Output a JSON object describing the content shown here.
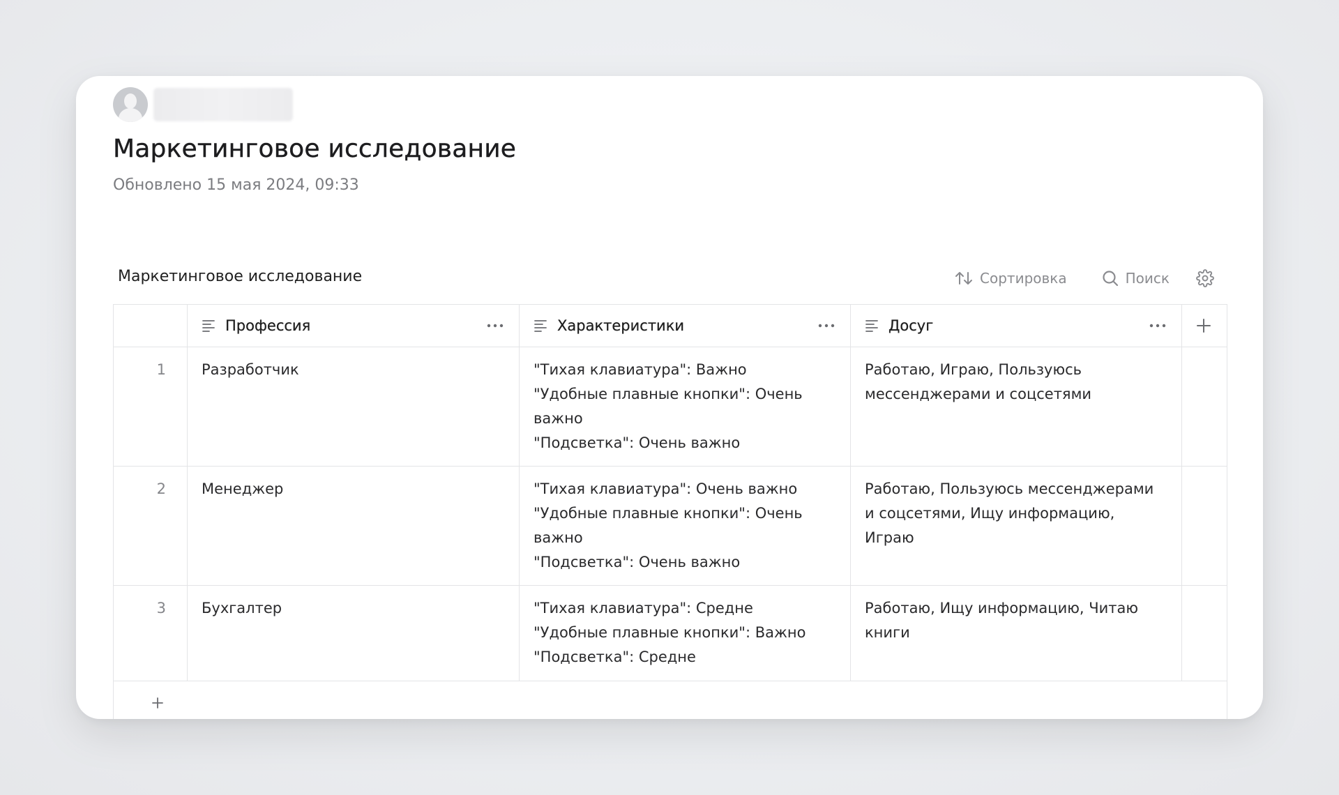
{
  "author": {
    "name": "",
    "avatar_icon": "user-avatar-icon"
  },
  "page": {
    "title": "Маркетинговое исследование",
    "updated": "Обновлено 15 мая 2024, 09:33"
  },
  "table": {
    "title": "Маркетинговое исследование",
    "toolbar": {
      "sort_label": "Сортировка",
      "sort_icon": "sort-icon",
      "search_label": "Поиск",
      "search_icon": "search-icon",
      "settings_icon": "gear-icon"
    },
    "columns": [
      {
        "label": "Профессия",
        "icon": "text-column-icon"
      },
      {
        "label": "Характеристики",
        "icon": "text-column-icon"
      },
      {
        "label": "Досуг",
        "icon": "text-column-icon"
      }
    ],
    "rows": [
      {
        "num": "1",
        "profession": "Разработчик",
        "characteristics": [
          "\"Тихая клавиатура\": Важно",
          "\"Удобные плавные кнопки\": Очень",
          "важно",
          "\"Подсветка\": Очень важно"
        ],
        "leisure": [
          "Работаю, Играю, Пользуюсь",
          "мессенджерами и соцсетями"
        ]
      },
      {
        "num": "2",
        "profession": "Менеджер",
        "characteristics": [
          "\"Тихая клавиатура\": Очень важно",
          "\"Удобные плавные кнопки\": Очень",
          "важно",
          "\"Подсветка\": Очень важно"
        ],
        "leisure": [
          "Работаю, Пользуюсь мессенджерами",
          "и соцсетями, Ищу информацию,",
          "Играю"
        ]
      },
      {
        "num": "3",
        "profession": "Бухгалтер",
        "characteristics": [
          "\"Тихая клавиатура\": Средне",
          "\"Удобные плавные кнопки\": Важно",
          "\"Подсветка\": Средне"
        ],
        "leisure": [
          "Работаю, Ищу информацию, Читаю",
          "книги"
        ]
      }
    ]
  },
  "colors": {
    "text": "#1f1f1f",
    "muted": "#7b7c80",
    "border": "#e3e4e6",
    "background": "#e9eaed",
    "card": "#ffffff"
  }
}
